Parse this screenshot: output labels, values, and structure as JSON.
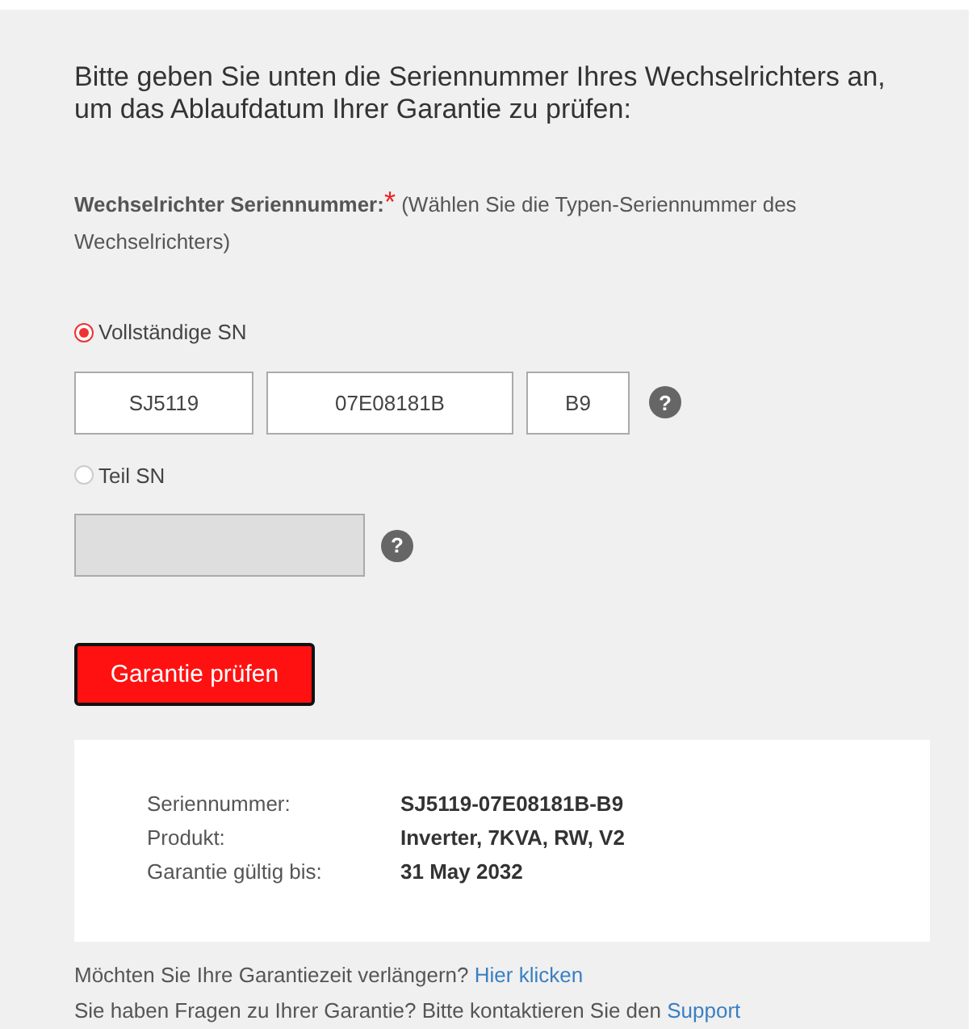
{
  "heading": "Bitte geben Sie unten die Seriennummer Ihres Wechselrichters an, um das Ablaufdatum Ihrer Garantie zu prüfen:",
  "serial_label": {
    "label": "Wechselrichter Seriennummer:",
    "required_mark": "*",
    "hint": "(Wählen Sie die Typen-Seriennummer des Wechselrichters)"
  },
  "options": [
    {
      "label": "Vollständige SN",
      "selected": true,
      "help": "?",
      "fields": [
        {
          "value": "SJ5119",
          "disabled": false
        },
        {
          "value": "07E08181B",
          "disabled": false
        },
        {
          "value": "B9",
          "disabled": false
        }
      ]
    },
    {
      "label": "Teil SN",
      "selected": false,
      "help": "?",
      "fields": [
        {
          "disabled": true
        }
      ]
    }
  ],
  "submit_button": "Garantie prüfen",
  "result": [
    {
      "label": "Seriennummer:",
      "value": "SJ5119-07E08181B-B9"
    },
    {
      "label": "Produkt:",
      "value": "Inverter, 7KVA, RW, V2"
    },
    {
      "label": "Garantie gültig bis:",
      "value": "31 May 2032"
    }
  ],
  "footer": [
    {
      "text": "Möchten Sie Ihre Garantiezeit verlängern?",
      "link": "Hier klicken"
    },
    {
      "text": "Sie haben Fragen zu Ihrer Garantie? Bitte kontaktieren Sie den",
      "link": "Support"
    }
  ]
}
